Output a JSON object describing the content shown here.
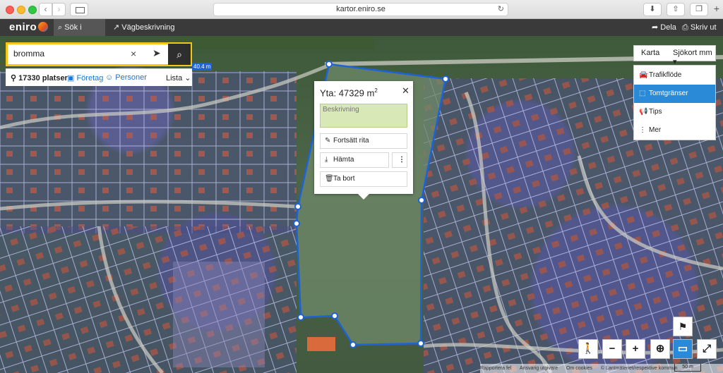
{
  "browser": {
    "url": "kartor.eniro.se"
  },
  "topbar": {
    "logo": "eniro",
    "search_label": "Sök i kartan",
    "route_label": "Vägbeskrivning",
    "share_label": "Dela",
    "print_label": "Skriv ut"
  },
  "search": {
    "value": "bromma",
    "clear": "×",
    "results_count": "17330 platser",
    "companies": "Företag",
    "people": "Personer",
    "list": "Lista"
  },
  "map": {
    "scale_tag": "40.4 m"
  },
  "popup": {
    "title_prefix": "Yta: 47329 m",
    "title_sup": "2",
    "description_placeholder": "Beskrivning",
    "continue_label": "Fortsätt rita",
    "fetch_label": "Hämta",
    "more_label": "⋮",
    "delete_label": "Ta bort"
  },
  "maptype": {
    "karta": "Karta",
    "selected": "Sjökort mm"
  },
  "layers": [
    {
      "label": "Trafikflöde",
      "icon": "car-icon",
      "active": false
    },
    {
      "label": "Tomtgränser",
      "icon": "plot-boundary-icon",
      "active": true
    },
    {
      "label": "Tips",
      "icon": "megaphone-icon",
      "active": false
    },
    {
      "label": "Mer",
      "icon": "more-vertical-icon",
      "active": false
    }
  ],
  "footer": {
    "report": "Rapportera fel",
    "responsible": "Ansvarig utgivare",
    "cookies": "Om cookies",
    "copyright": "© Lantmäteriet/respektive kommun",
    "scale": "50 m"
  },
  "colors": {
    "accent": "#2b8ad8",
    "search_border": "#f5c518",
    "polygon": "#1e63d6"
  }
}
